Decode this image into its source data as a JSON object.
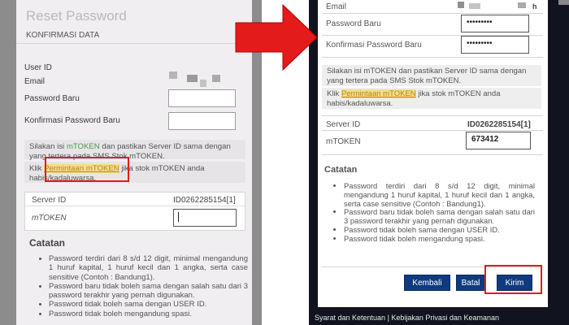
{
  "left": {
    "title": "Reset Password",
    "section": "KONFIRMASI DATA",
    "fields": {
      "user_id": "User ID",
      "email": "Email",
      "password_baru": "Password Baru",
      "konfirmasi_password": "Konfirmasi Password Baru"
    },
    "info_text_1a": "Silakan isi ",
    "info_text_1b": "mTOKEN",
    "info_text_1c": " dan pastikan Server ID sama dengan yang tertera pada SMS Stok mTOKEN.",
    "info_text_2a": "Klik ",
    "info_link": "Permintaan mTOKEN",
    "info_text_2b": " jika stok mTOKEN anda habis/kadaluwarsa.",
    "server_id_label": "Server ID",
    "server_id_value": "ID0262285154[1]",
    "mtoken_label": "mTOKEN",
    "mtoken_value": "",
    "catatan_title": "Catatan",
    "notes": [
      "Password terdiri dari 8 s/d 12 digit, minimal mengandung 1 huruf kapital, 1 huruf kecil dan 1 angka, serta case sensitive (Contoh : Bandung1).",
      "Password baru tidak boleh sama dengan salah satu dari 3 password terakhir yang pernah digunakan.",
      "Password tidak boleh sama dengan USER ID.",
      "Password tidak boleh mengandung spasi."
    ]
  },
  "right": {
    "email_label": "Email",
    "password_baru_label": "Password Baru",
    "password_baru_value": "•••••••••",
    "konfirmasi_label": "Konfirmasi Password Baru",
    "konfirmasi_value": "•••••••••",
    "info_text_1": "Silakan isi mTOKEN dan pastikan Server ID sama dengan yang tertera pada SMS Stok mTOKEN.",
    "info_text_2a": "Klik ",
    "info_link": "Permintaan mTOKEN",
    "info_text_2b": " jika stok mTOKEN anda habis/kadaluwarsa.",
    "server_id_label": "Server ID",
    "server_id_value": "ID0262285154[1]",
    "mtoken_label": "mTOKEN",
    "mtoken_value": "673412",
    "catatan_title": "Catatan",
    "notes": [
      "Password terdiri dari 8 s/d 12 digit, minimal mengandung 1 huruf kapital, 1 huruf kecil dan 1 angka, serta case sensitive (Contoh : Bandung1).",
      "Password baru tidak boleh sama dengan salah satu dari 3 password terakhir yang pernah digunakan.",
      "Password tidak boleh sama dengan USER ID.",
      "Password tidak boleh mengandung spasi."
    ],
    "buttons": {
      "kembali": "Kembali",
      "batal": "Batal",
      "kirim": "Kirim"
    },
    "footer": "Syarat dan Ketentuan | Kebijakan Privasi dan Keamanan"
  },
  "colors": {
    "annotation_red": "#e31b1b",
    "button_blue": "#0f3a80",
    "link_highlight": "#f3dc8d"
  }
}
